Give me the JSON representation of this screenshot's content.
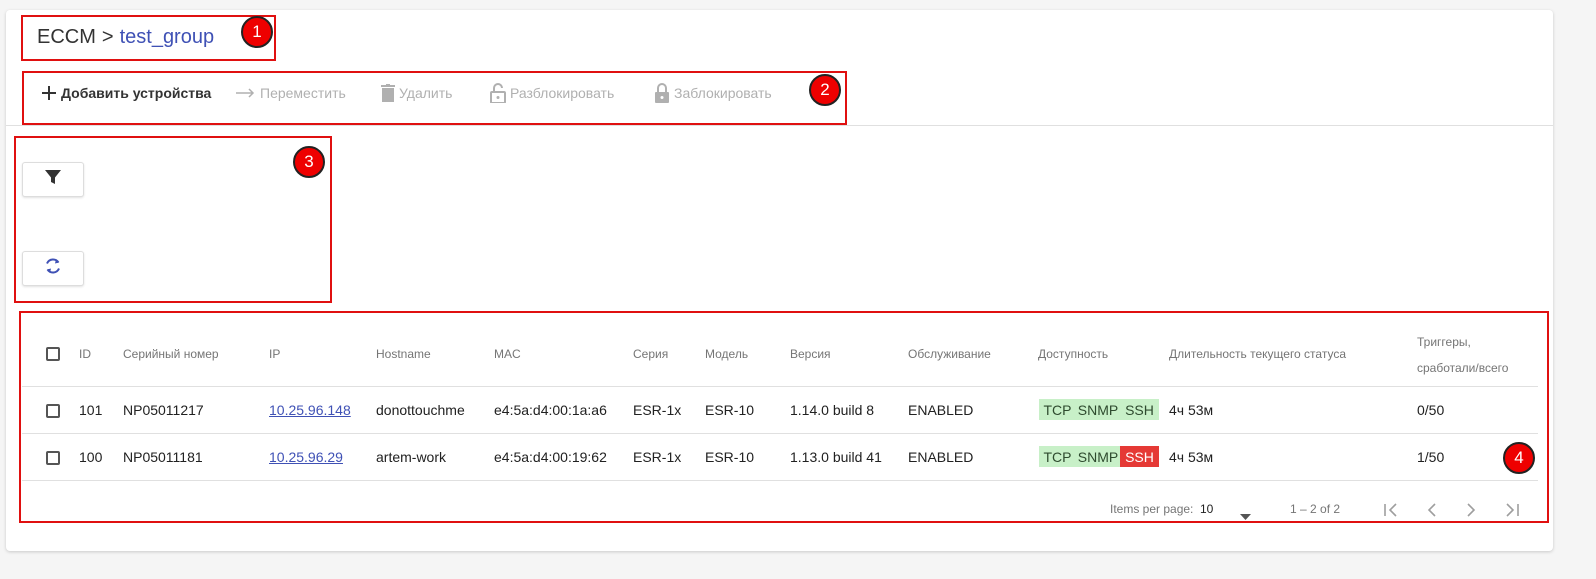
{
  "breadcrumb": {
    "root": "ECCM",
    "separator": ">",
    "current": "test_group"
  },
  "toolbar": {
    "add": "Добавить устройства",
    "move": "Переместить",
    "delete": "Удалить",
    "unlock": "Разблокировать",
    "lock": "Заблокировать"
  },
  "annotations": [
    "1",
    "2",
    "3",
    "4"
  ],
  "table": {
    "headers": {
      "id": "ID",
      "serial": "Серийный номер",
      "ip": "IP",
      "hostname": "Hostname",
      "mac": "MAC",
      "series": "Серия",
      "model": "Модель",
      "version": "Версия",
      "service": "Обслуживание",
      "availability": "Доступность",
      "duration": "Длительность текущего статуса",
      "triggers_line1": "Триггеры,",
      "triggers_line2": "сработали/всего"
    },
    "rows": [
      {
        "id": "101",
        "serial": "NP05011217",
        "ip": "10.25.96.148",
        "hostname": "donottouchme",
        "mac": "e4:5a:d4:00:1a:a6",
        "series": "ESR-1x",
        "model": "ESR-10",
        "version": "1.14.0 build 8",
        "service": "ENABLED",
        "tcp": "TCP",
        "snmp": "SNMP",
        "ssh": "SSH",
        "ssh_status": "ok",
        "duration": "4ч 53м",
        "triggers": "0/50"
      },
      {
        "id": "100",
        "serial": "NP05011181",
        "ip": "10.25.96.29",
        "hostname": "artem-work",
        "mac": "e4:5a:d4:00:19:62",
        "series": "ESR-1x",
        "model": "ESR-10",
        "version": "1.13.0 build 41",
        "service": "ENABLED",
        "tcp": "TCP",
        "snmp": "SNMP",
        "ssh": "SSH",
        "ssh_status": "error",
        "duration": "4ч 53м",
        "triggers": "1/50"
      }
    ]
  },
  "pagination": {
    "items_per_page_label": "Items per page:",
    "items_per_page": "10",
    "range": "1 – 2 of 2"
  },
  "colors": {
    "accent": "#3f51b5",
    "ok": "#c8f0c8",
    "error": "#e53935",
    "annotation": "#e01010"
  }
}
